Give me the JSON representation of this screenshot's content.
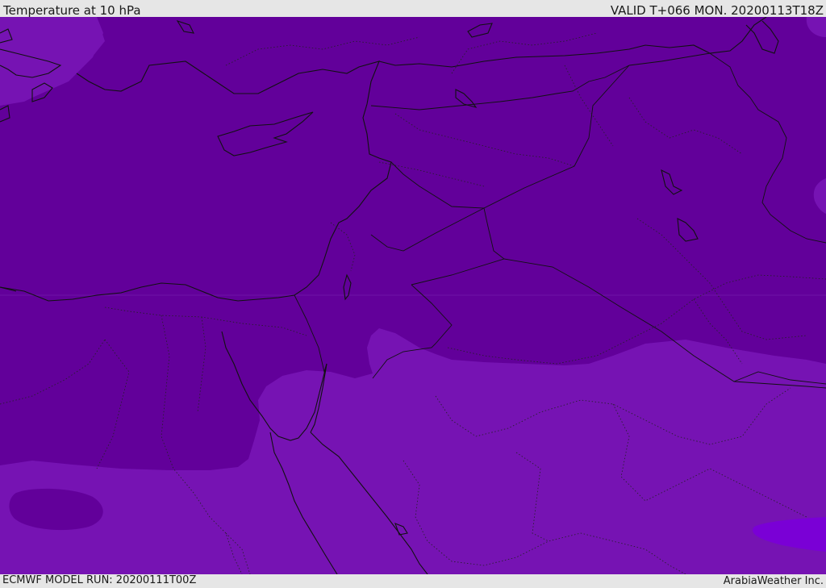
{
  "header": {
    "title": "Temperature at 10 hPa",
    "valid_time": "VALID T+066 MON. 20200113T18Z"
  },
  "footer": {
    "model_run": "ECMWF MODEL RUN: 20200111T00Z",
    "credit": "ArabiaWeather Inc."
  },
  "colors": {
    "band_cold": "#62009a",
    "band_mid": "#7613b3",
    "band_warm": "#7a00d6"
  }
}
